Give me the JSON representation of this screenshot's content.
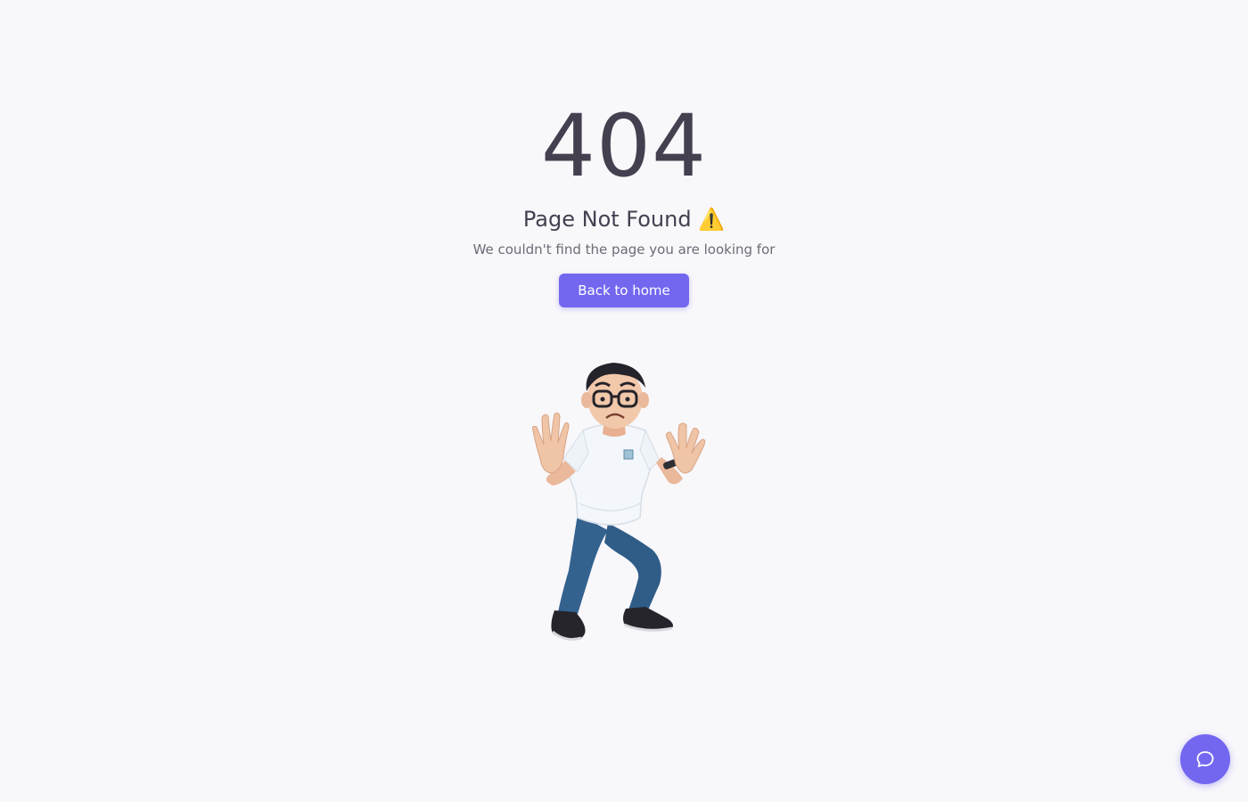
{
  "error": {
    "code": "404",
    "title": "Page Not Found ⚠️",
    "message": "We couldn't find the page you are looking for",
    "button_label": "Back to home"
  },
  "icons": {
    "chat": "chat-bubble-icon"
  },
  "colors": {
    "background": "#f8f7fa",
    "primary": "#7367f0",
    "heading": "#444050",
    "body_text": "#6d6b77"
  }
}
